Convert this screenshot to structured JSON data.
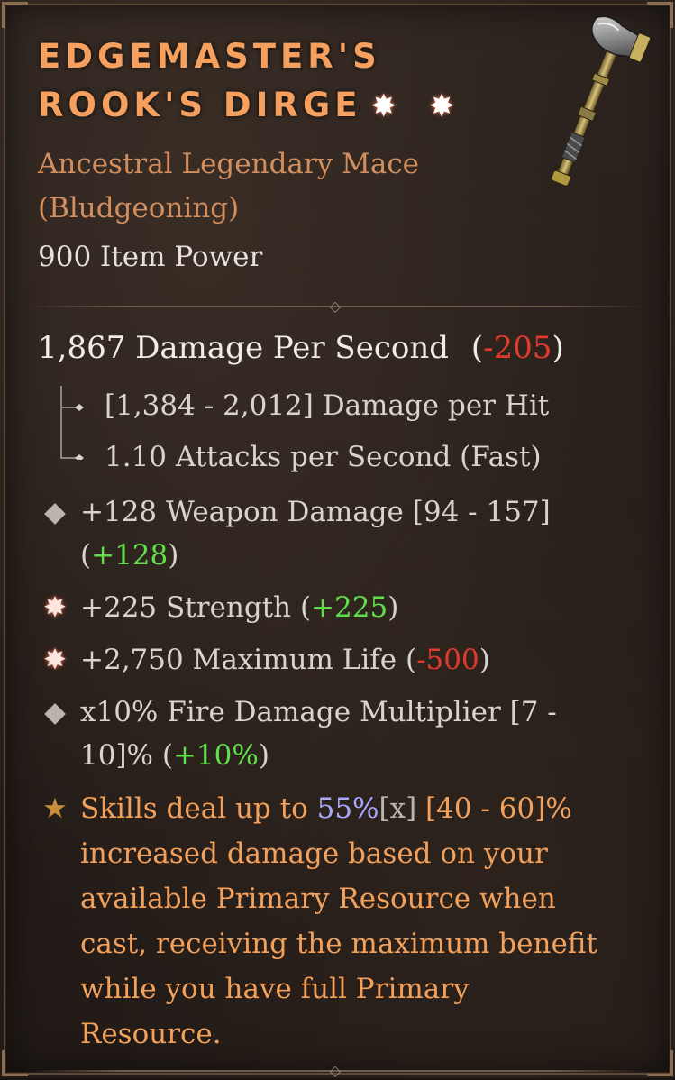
{
  "item": {
    "name_line1": "EDGEMASTER'S",
    "name_line2": "ROOK'S DIRGE",
    "name_glyphs": "✸ ✸",
    "type_line": "Ancestral Legendary Mace (Bludgeoning)",
    "item_power": "900 Item Power",
    "icon": "mace-icon"
  },
  "dps": {
    "label": "1,867 Damage Per Second",
    "delta": "-205"
  },
  "sub_stats": {
    "damage_per_hit": "[1,384 - 2,012] Damage per Hit",
    "attacks_per_second": "1.10 Attacks per Second (Fast)"
  },
  "affixes": {
    "weapon_damage": {
      "text": "+128 Weapon Damage [94 - 157] (",
      "delta": "+128",
      "close": ")"
    },
    "strength": {
      "text": "+225 Strength (",
      "delta": "+225",
      "close": ")"
    },
    "max_life": {
      "text": "+2,750 Maximum Life (",
      "delta": "-500",
      "close": ")"
    },
    "fire_mult": {
      "text": "x10% Fire Damage Multiplier [7 - 10]% (",
      "delta": "+10%",
      "close": ")"
    },
    "legendary": {
      "pre": "Skills deal up to ",
      "value": "55%",
      "x_tag": "[x]",
      "post": " [40 - 60]% increased damage based on your available Primary Resource when cast, receiving the maximum benefit while you have full Primary Resource."
    }
  },
  "colors": {
    "title": "#f5a05e",
    "legendary": "#f2a05a",
    "positive": "#5fe04a",
    "negative": "#e03a2e"
  }
}
